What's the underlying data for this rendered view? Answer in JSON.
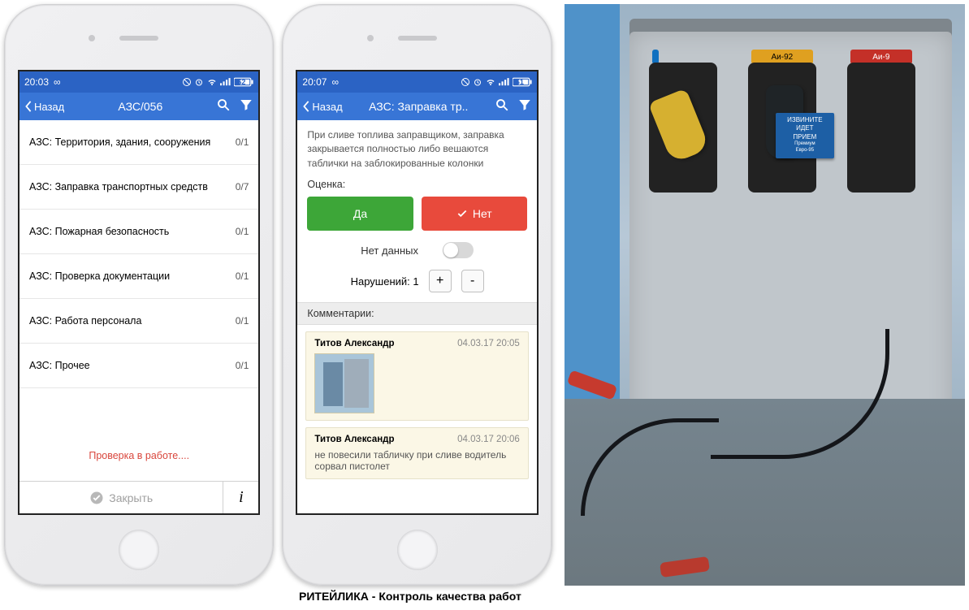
{
  "caption": "РИТЕЙЛИКА - Контроль качества работ",
  "phone1": {
    "status": {
      "time": "20:03",
      "infinity": "∞",
      "battery": "62"
    },
    "nav": {
      "back": "Назад",
      "title": "АЗС/056"
    },
    "items": [
      {
        "label": "АЗС: Территория, здания, сооружения",
        "count": "0/1"
      },
      {
        "label": "АЗС: Заправка транспортных средств",
        "count": "0/7"
      },
      {
        "label": "АЗС: Пожарная безопасность",
        "count": "0/1"
      },
      {
        "label": "АЗС: Проверка документации",
        "count": "0/1"
      },
      {
        "label": "АЗС: Работа персонала",
        "count": "0/1"
      },
      {
        "label": "АЗС: Прочее",
        "count": "0/1"
      }
    ],
    "workStatus": "Проверка в работе....",
    "closeLabel": "Закрыть",
    "infoLabel": "i"
  },
  "phone2": {
    "status": {
      "time": "20:07",
      "infinity": "∞",
      "battery": "61"
    },
    "nav": {
      "back": "Назад",
      "title": "АЗС: Заправка тр.."
    },
    "question": "При сливе топлива заправщиком, заправка закрывается полностью либо вешаются таблички на заблокированные колонки",
    "ratingLabel": "Оценка:",
    "yes": "Да",
    "no": "Нет",
    "noDataLabel": "Нет данных",
    "violationsLabel": "Нарушений: 1",
    "commentsHead": "Комментарии:",
    "comments": [
      {
        "author": "Титов Александр",
        "date": "04.03.17 20:05",
        "hasImage": true,
        "text": ""
      },
      {
        "author": "Титов Александр",
        "date": "04.03.17 20:06",
        "hasImage": false,
        "text": "не повесили табличку при сливе водитель сорвал пистолет"
      }
    ]
  },
  "photo": {
    "slotLabels": [
      "",
      "Аи-92",
      "Аи-9"
    ],
    "signLines": [
      "ИЗВИНИТЕ",
      "ИДЕТ",
      "ПРИЕМ",
      "Премиум",
      "Евро-95"
    ]
  }
}
